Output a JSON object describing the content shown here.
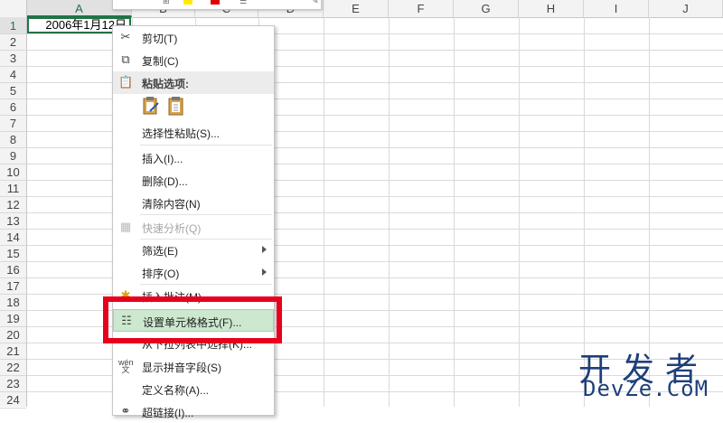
{
  "sheet": {
    "columns": [
      "A",
      "B",
      "C",
      "D",
      "E",
      "F",
      "G",
      "H",
      "I",
      "J"
    ],
    "rows": [
      "1",
      "2",
      "3",
      "4",
      "5",
      "6",
      "7",
      "8",
      "9",
      "10",
      "11",
      "12",
      "13",
      "14",
      "15",
      "16",
      "17",
      "18",
      "19",
      "20",
      "21",
      "22",
      "23",
      "24"
    ],
    "selected_cell_value": "2006年1月12日",
    "selected_column": "A",
    "selected_row": "1"
  },
  "menu": {
    "cut": "剪切(T)",
    "copy": "复制(C)",
    "paste_options": "粘贴选项:",
    "paste_special": "选择性粘贴(S)...",
    "insert": "插入(I)...",
    "delete": "删除(D)...",
    "clear_contents": "清除内容(N)",
    "quick_analysis": "快速分析(Q)",
    "filter": "筛选(E)",
    "sort": "排序(O)",
    "insert_comment": "插入批注(M)",
    "format_cells": "设置单元格格式(F)...",
    "pick_from_list": "从下拉列表中选择(K)...",
    "show_phonetic": "显示拼音字段(S)",
    "define_name": "定义名称(A)...",
    "hyperlink": "超链接(I)..."
  },
  "watermark": {
    "cn": "开发者",
    "en": "DevZe.CoM"
  },
  "colors": {
    "accent": "#217346",
    "highlight": "#cce8cf",
    "annotation": "#e8001c",
    "watermark": "#1f3f7a"
  }
}
